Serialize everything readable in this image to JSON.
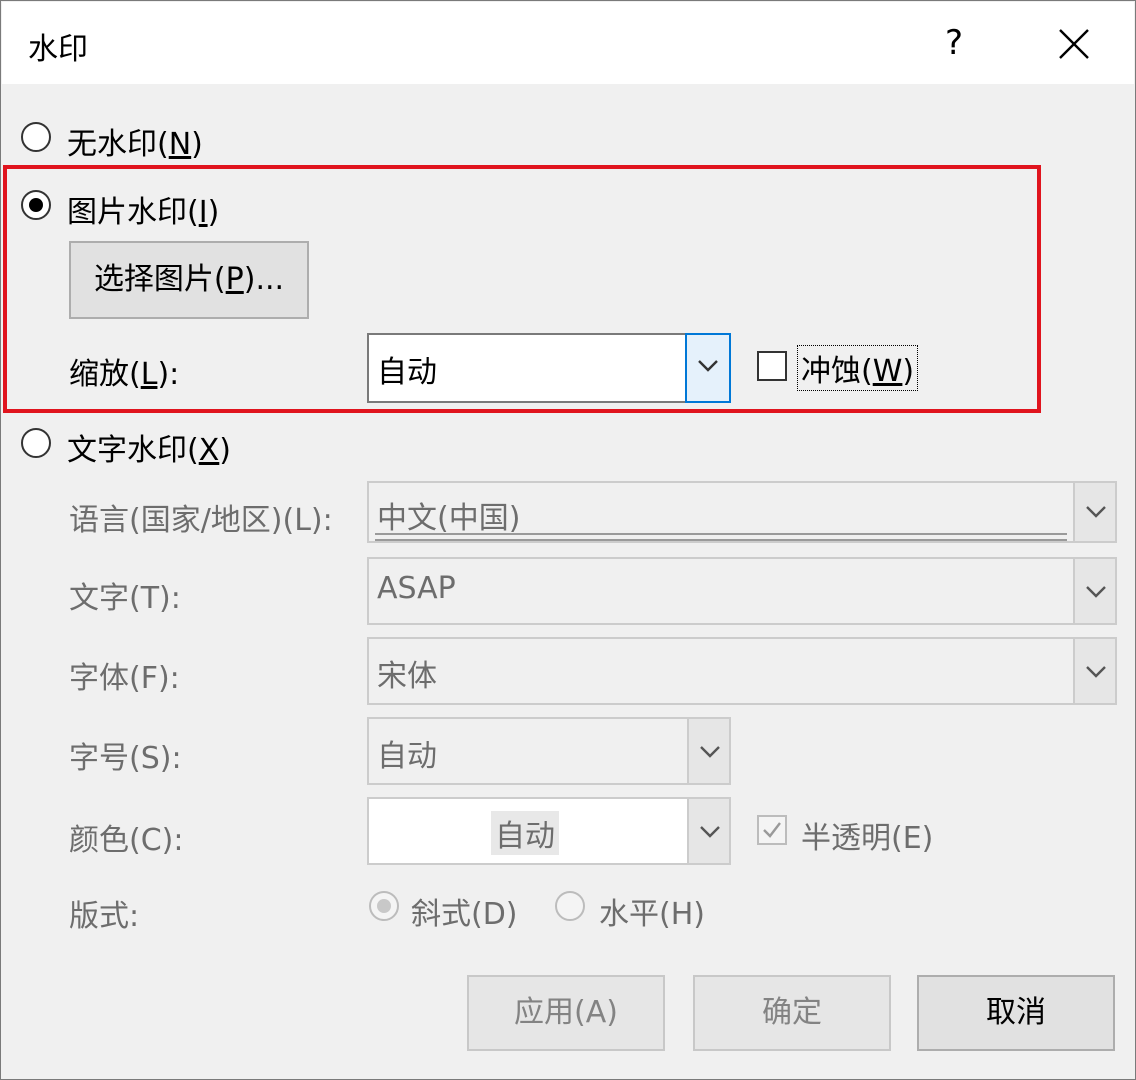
{
  "window": {
    "title": "水印",
    "help_label": "?",
    "close_label": "×"
  },
  "no_watermark": {
    "label_prefix": "无水印(",
    "mnemonic": "N",
    "label_suffix": ")",
    "selected": false
  },
  "picture_watermark": {
    "label_prefix": "图片水印(",
    "mnemonic": "I",
    "label_suffix": ")",
    "selected": true,
    "select_picture": {
      "label_prefix": "选择图片(",
      "mnemonic": "P",
      "label_suffix": ")..."
    },
    "scale": {
      "label_prefix": "缩放(",
      "mnemonic": "L",
      "label_suffix": "):",
      "value": "自动"
    },
    "washout": {
      "label_prefix": "冲蚀(",
      "mnemonic": "W",
      "label_suffix": ")",
      "checked": false
    }
  },
  "text_watermark": {
    "label_prefix": "文字水印(",
    "mnemonic": "X",
    "label_suffix": ")",
    "selected": false,
    "language": {
      "label": "语言(国家/地区)(L):",
      "value": "中文(中国)"
    },
    "text": {
      "label": "文字(T):",
      "value": "ASAP"
    },
    "font": {
      "label": "字体(F):",
      "value": "宋体"
    },
    "size": {
      "label": "字号(S):",
      "value": "自动"
    },
    "color": {
      "label": "颜色(C):",
      "value": "自动"
    },
    "semitransparent": {
      "label": "半透明(E)",
      "checked": true
    },
    "layout": {
      "label": "版式:",
      "options": [
        {
          "label": "斜式(D)",
          "selected": true
        },
        {
          "label": "水平(H)",
          "selected": false
        }
      ]
    }
  },
  "buttons": {
    "apply": "应用(A)",
    "ok": "确定",
    "cancel": "取消"
  },
  "colors": {
    "highlight_border": "#e0141e",
    "focus_border": "#0078d7"
  }
}
